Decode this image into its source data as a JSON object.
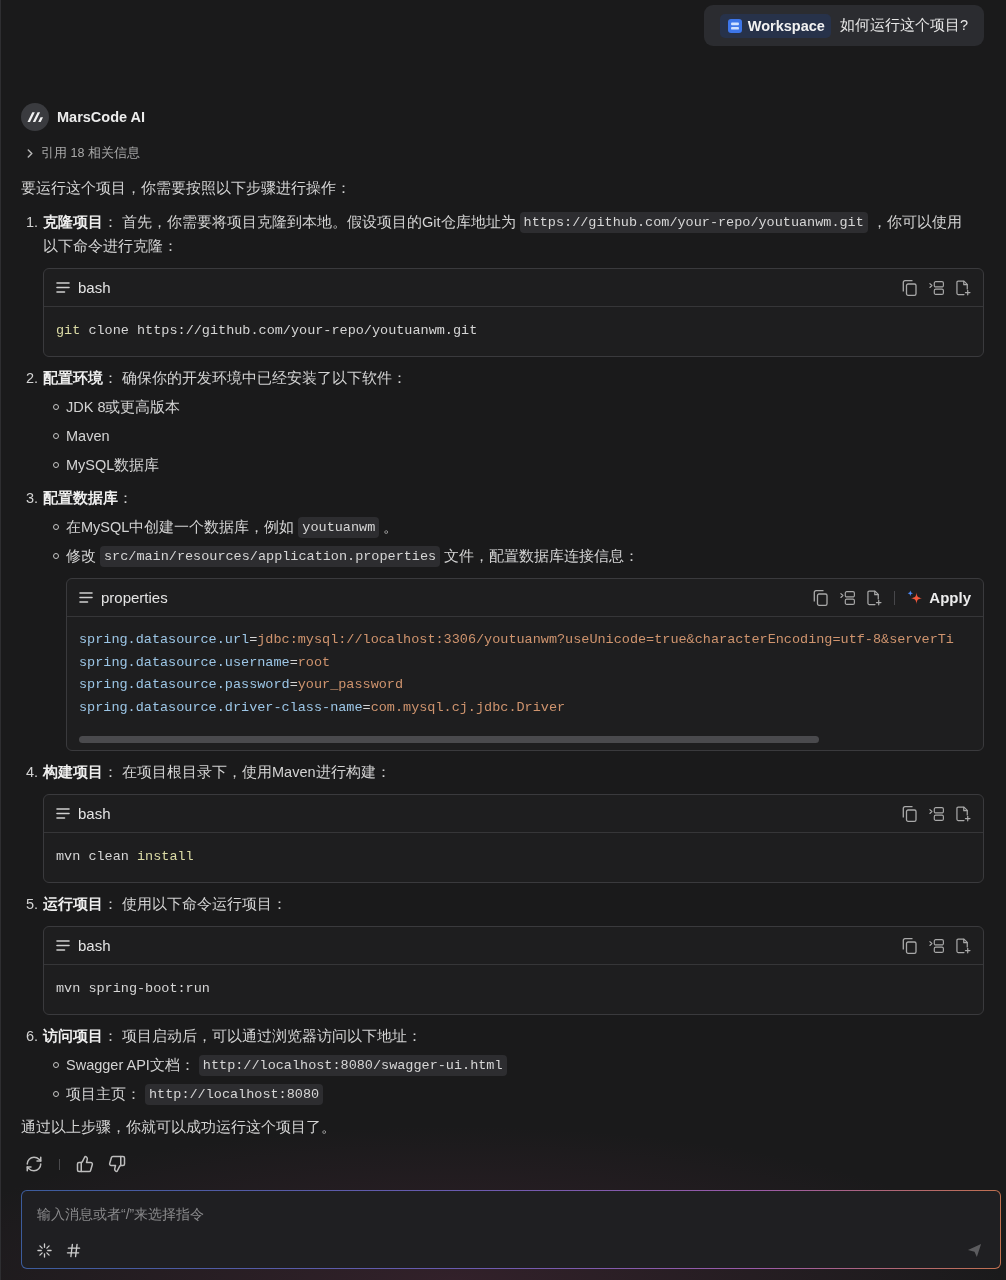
{
  "user_message": {
    "chip": {
      "label": "Workspace"
    },
    "text": "如何运行这个项目?"
  },
  "assistant": {
    "name": "MarsCode AI",
    "references": {
      "label": "引用 18 相关信息",
      "expanded": false
    }
  },
  "intro": "要运行这个项目，你需要按照以下步骤进行操作：",
  "steps": [
    {
      "number": "1.",
      "parts": [
        {
          "kind": "text",
          "text": "**克隆项目**： 首先，你需要将项目克隆到本地。假设项目的Git仓库地址为"
        },
        {
          "kind": "code",
          "text": "https://github.com/your-repo/youtuanwm.git"
        },
        {
          "kind": "text",
          "text": "，你可以使用"
        },
        {
          "kind": "text",
          "text": "以下命令进行克隆："
        }
      ],
      "code_block": {
        "language": "bash",
        "lines": [
          {
            "tokens": [
              {
                "kind": "command",
                "text": "git"
              },
              {
                "kind": "plain",
                "text": " clone https://github.com/your-repo/youtuanwm.git"
              }
            ]
          }
        ]
      }
    },
    {
      "number": "2.",
      "parts": [
        {
          "kind": "text",
          "text": "**配置环境**： 确保你的开发环境中已经安装了以下软件："
        }
      ],
      "bullets": [
        {
          "parts": [
            {
              "kind": "text",
              "text": "JDK 8或更高版本"
            }
          ]
        },
        {
          "parts": [
            {
              "kind": "text",
              "text": "Maven"
            }
          ]
        },
        {
          "parts": [
            {
              "kind": "text",
              "text": "MySQL数据库"
            }
          ]
        }
      ]
    },
    {
      "number": "3.",
      "parts": [
        {
          "kind": "text",
          "text": "**配置数据库**："
        }
      ],
      "bullets": [
        {
          "parts": [
            {
              "kind": "text",
              "text": "在MySQL中创建一个数据库，例如"
            },
            {
              "kind": "code",
              "text": "youtuanwm"
            },
            {
              "kind": "text",
              "text": "。"
            }
          ]
        },
        {
          "parts": [
            {
              "kind": "text",
              "text": "修改"
            },
            {
              "kind": "code",
              "text": "src/main/resources/application.properties"
            },
            {
              "kind": "text",
              "text": "文件，配置数据库连接信息："
            }
          ],
          "code_block": {
            "language": "properties",
            "apply_button": {
              "label": "Apply"
            },
            "horizontal_scrollbar": true,
            "lines": [
              {
                "tokens": [
                  {
                    "kind": "key",
                    "text": "spring.datasource.url"
                  },
                  {
                    "kind": "operator",
                    "text": "="
                  },
                  {
                    "kind": "value",
                    "text": "jdbc:mysql://localhost:3306/youtuanwm?useUnicode=true&characterEncoding=utf-8&serverTi"
                  }
                ]
              },
              {
                "tokens": [
                  {
                    "kind": "key",
                    "text": "spring.datasource.username"
                  },
                  {
                    "kind": "operator",
                    "text": "="
                  },
                  {
                    "kind": "value",
                    "text": "root"
                  }
                ]
              },
              {
                "tokens": [
                  {
                    "kind": "key",
                    "text": "spring.datasource.password"
                  },
                  {
                    "kind": "operator",
                    "text": "="
                  },
                  {
                    "kind": "value",
                    "text": "your_password"
                  }
                ]
              },
              {
                "tokens": [
                  {
                    "kind": "key",
                    "text": "spring.datasource.driver-class-name"
                  },
                  {
                    "kind": "operator",
                    "text": "="
                  },
                  {
                    "kind": "value",
                    "text": "com.mysql.cj.jdbc.Driver"
                  }
                ]
              }
            ]
          }
        }
      ]
    },
    {
      "number": "4.",
      "parts": [
        {
          "kind": "text",
          "text": "**构建项目**： 在项目根目录下，使用Maven进行构建："
        }
      ],
      "code_block": {
        "language": "bash",
        "lines": [
          {
            "tokens": [
              {
                "kind": "plain",
                "text": "mvn clean "
              },
              {
                "kind": "command",
                "text": "install"
              }
            ]
          }
        ]
      }
    },
    {
      "number": "5.",
      "parts": [
        {
          "kind": "text",
          "text": "**运行项目**： 使用以下命令运行项目："
        }
      ],
      "code_block": {
        "language": "bash",
        "lines": [
          {
            "tokens": [
              {
                "kind": "plain",
                "text": "mvn spring-boot:run"
              }
            ]
          }
        ]
      }
    },
    {
      "number": "6.",
      "parts": [
        {
          "kind": "text",
          "text": "**访问项目**： 项目启动后，可以通过浏览器访问以下地址："
        }
      ],
      "bullets": [
        {
          "parts": [
            {
              "kind": "text",
              "text": "Swagger API文档："
            },
            {
              "kind": "code",
              "text": "http://localhost:8080/swagger-ui.html"
            }
          ]
        },
        {
          "parts": [
            {
              "kind": "text",
              "text": "项目主页："
            },
            {
              "kind": "code",
              "text": "http://localhost:8080"
            }
          ]
        }
      ]
    }
  ],
  "conclusion": "通过以上步骤，你就可以成功运行这个项目了。",
  "composer": {
    "placeholder": "输入消息或者“/”来选择指令"
  }
}
